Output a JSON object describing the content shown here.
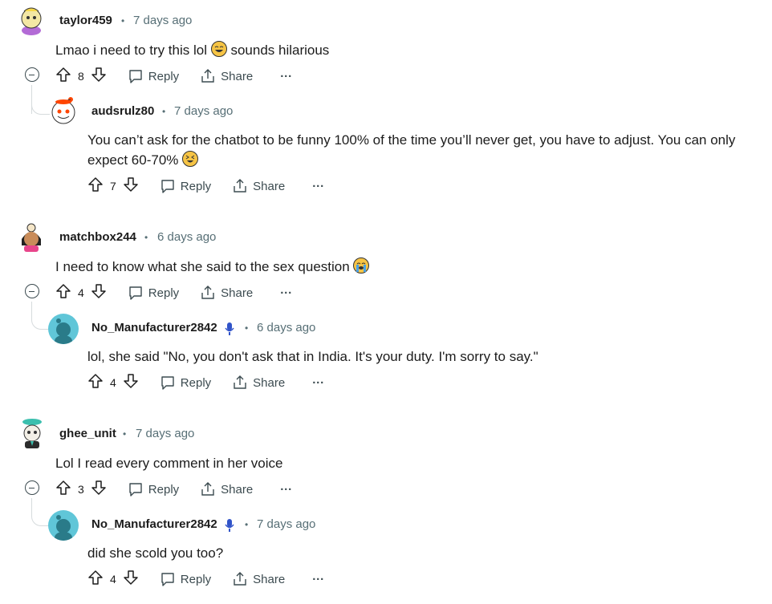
{
  "actions": {
    "reply": "Reply",
    "share": "Share",
    "more": "···"
  },
  "comments": [
    {
      "user": "taylor459",
      "time": "7 days ago",
      "text_pre": "Lmao i need to try this lol",
      "text_post": "sounds hilarious",
      "emoji": "tears-of-joy",
      "votes": "8",
      "reply": {
        "user": "audsrulz80",
        "time": "7 days ago",
        "text_line1": "You can’t ask for the chatbot to be funny 100% of the time you’ll never get, you have to adjust. You can only",
        "text_line2": "expect 60-70%",
        "emoji": "laughing-squint",
        "votes": "7"
      }
    },
    {
      "user": "matchbox244",
      "time": "6 days ago",
      "text_pre": "I need to know what she said to the sex question",
      "emoji": "loudly-crying",
      "votes": "4",
      "reply": {
        "user": "No_Manufacturer2842",
        "time": "6 days ago",
        "text": "lol, she said \"No, you don't ask that in India. It's your duty. I'm sorry to say.\"",
        "votes": "4"
      }
    },
    {
      "user": "ghee_unit",
      "time": "7 days ago",
      "text_pre": "Lol I read every comment in her voice",
      "votes": "3",
      "reply": {
        "user": "No_Manufacturer2842",
        "time": "7 days ago",
        "text": "did she scold you too?",
        "votes": "4"
      }
    }
  ]
}
